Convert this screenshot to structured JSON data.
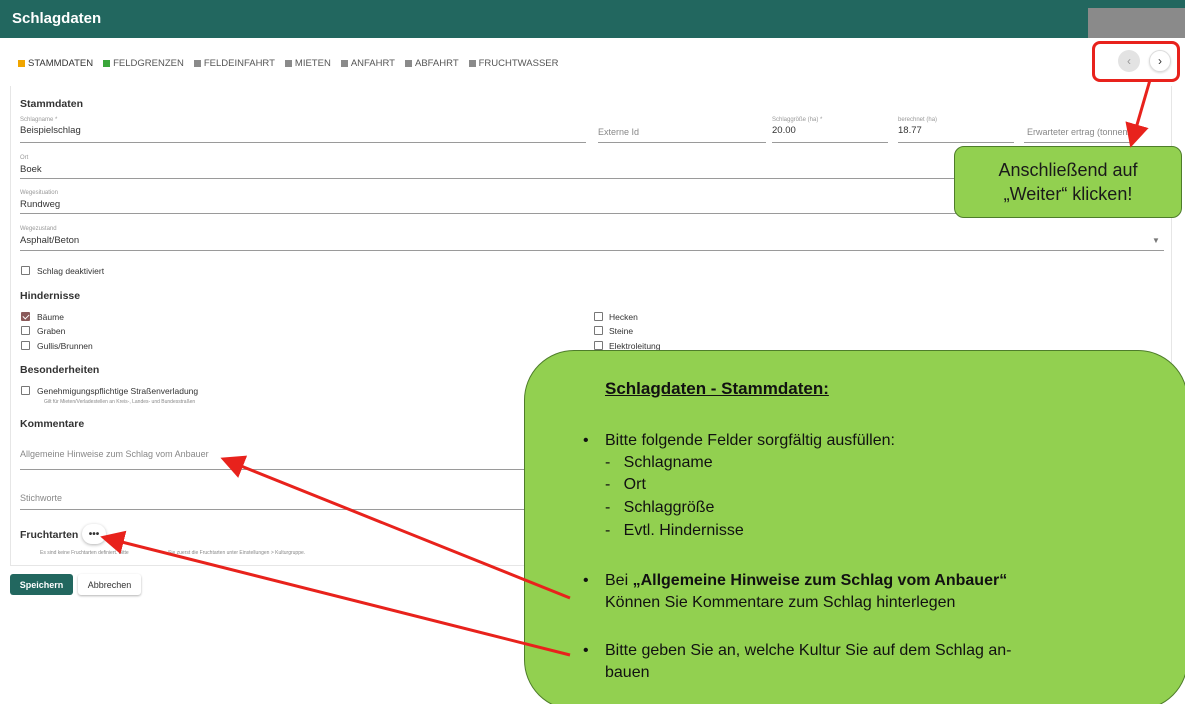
{
  "header": {
    "title": "Schlagdaten"
  },
  "tabs": [
    {
      "label": "STAMMDATEN",
      "color": "#f0a500",
      "active": true
    },
    {
      "label": "FELDGRENZEN",
      "color": "#3aa63a"
    },
    {
      "label": "FELDEINFAHRT",
      "color": "#8a8a8a"
    },
    {
      "label": "MIETEN",
      "color": "#8a8a8a"
    },
    {
      "label": "ANFAHRT",
      "color": "#8a8a8a"
    },
    {
      "label": "ABFAHRT",
      "color": "#8a8a8a"
    },
    {
      "label": "FRUCHTWASSER",
      "color": "#8a8a8a"
    }
  ],
  "nav": {
    "prev_icon": "chevron-left-icon",
    "next_icon": "chevron-right-icon",
    "prev_glyph": "‹",
    "next_glyph": "›"
  },
  "stammdaten": {
    "heading": "Stammdaten",
    "schlagname": {
      "label": "Schlagname *",
      "value": "Beispielschlag"
    },
    "externe_id": {
      "placeholder": "Externe Id"
    },
    "schlaggroesse": {
      "label": "Schlaggröße (ha) *",
      "value": "20.00"
    },
    "berechnet": {
      "label": "berechnet (ha)",
      "value": "18.77"
    },
    "ertrag": {
      "placeholder": "Erwarteter ertrag (tonnen/ha)"
    },
    "ort": {
      "label": "Ort",
      "value": "Boek"
    },
    "wegesituation": {
      "label": "Wegesituation",
      "value": "Rundweg"
    },
    "wegezustand": {
      "label": "Wegezustand",
      "value": "Asphalt/Beton"
    },
    "deaktiviert": {
      "label": "Schlag deaktiviert",
      "checked": false
    }
  },
  "hindernisse": {
    "heading": "Hindernisse",
    "items": [
      {
        "label": "Bäume",
        "checked": true
      },
      {
        "label": "Graben",
        "checked": false
      },
      {
        "label": "Gullis/Brunnen",
        "checked": false
      },
      {
        "label": "Hecken",
        "checked": false
      },
      {
        "label": "Steine",
        "checked": false
      },
      {
        "label": "Elektroleitung",
        "checked": false
      }
    ]
  },
  "besonderheiten": {
    "heading": "Besonderheiten",
    "item_label": "Genehmigungspflichtige Straßenverladung",
    "note": "Gilt für Mieten/Verladestellen an Kreis-, Landes- und Bundesstraßen"
  },
  "kommentare": {
    "heading": "Kommentare",
    "hinweise_placeholder": "Allgemeine Hinweise zum Schlag vom Anbauer",
    "stichworte_placeholder": "Stichworte"
  },
  "fruchtarten": {
    "heading": "Fruchtarten",
    "dots": "•••",
    "note_left": "Es sind keine Fruchtarten definiert. Bitte",
    "note_right": "Sie zuerst die Fruchtarten unter Einstellungen > Kulturgruppe."
  },
  "buttons": {
    "save": "Speichern",
    "cancel": "Abbrechen"
  },
  "callout_small": {
    "line1": "Anschließend auf",
    "line2": "„Weiter“ klicken!"
  },
  "callout_big": {
    "title": "Schlagdaten - Stammdaten:",
    "bullet1": "Bitte folgende Felder sorgfältig ausfüllen:",
    "sub_items": [
      "Schlagname",
      "Ort",
      "Schlaggröße",
      "Evtl. Hindernisse"
    ],
    "bullet2_prefix": "Bei ",
    "bullet2_bold": "„Allgemeine Hinweise zum Schlag vom Anbauer“",
    "bullet2_line2": "Können Sie Kommentare zum Schlag hinterlegen",
    "bullet3_line1": "Bitte geben Sie an, welche Kultur Sie auf dem Schlag an-",
    "bullet3_line2": "bauen"
  },
  "colors": {
    "header_bg": "#22675f",
    "callout_bg": "#92d050",
    "arrow": "#e8221c"
  }
}
